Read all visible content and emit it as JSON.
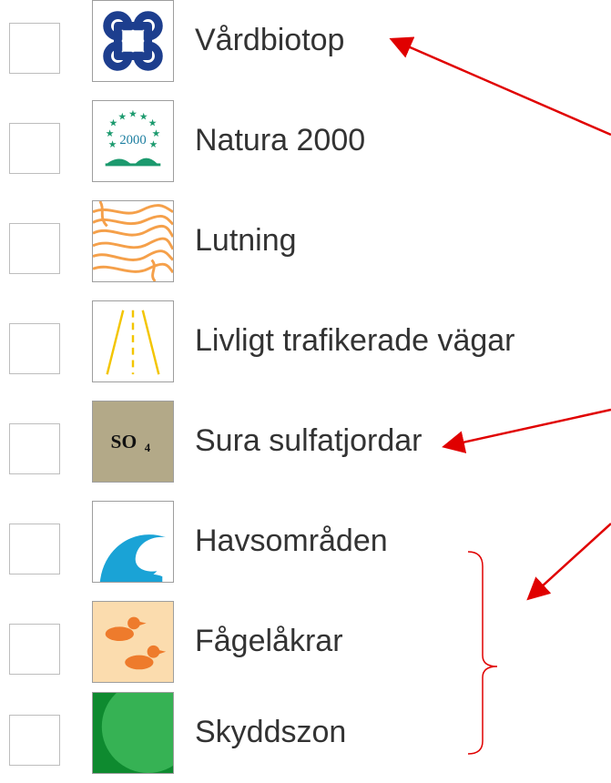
{
  "layers": [
    {
      "label": "Vårdbiotop",
      "icon": "command-key-icon",
      "checked": false
    },
    {
      "label": "Natura 2000",
      "icon": "natura-2000-icon",
      "checked": false
    },
    {
      "label": "Lutning",
      "icon": "contour-lines-icon",
      "checked": false
    },
    {
      "label": "Livligt trafikerade vägar",
      "icon": "road-icon",
      "checked": false
    },
    {
      "label": "Sura sulfatjordar",
      "icon": "so4-icon",
      "icon_text": "SO",
      "icon_subscript": "4",
      "checked": false
    },
    {
      "label": "Havsområden",
      "icon": "wave-icon",
      "checked": false
    },
    {
      "label": "Fågelåkrar",
      "icon": "ducks-icon",
      "checked": false
    },
    {
      "label": "Skyddszon",
      "icon": "protection-zone-icon",
      "checked": false
    }
  ],
  "natura_icon_text": "2000",
  "colors": {
    "arrow": "#e00000",
    "command_icon": "#1d3e8e",
    "natura_green": "#1c9a6e",
    "contour_orange": "#f5a04a",
    "road_yellow": "#f3c500",
    "so4_bg": "#b3a988",
    "wave_blue": "#1aa3d6",
    "ducks_bg": "#fbdcae",
    "duck_orange": "#ee7b2c",
    "zone_green": "#1c9a3f"
  }
}
